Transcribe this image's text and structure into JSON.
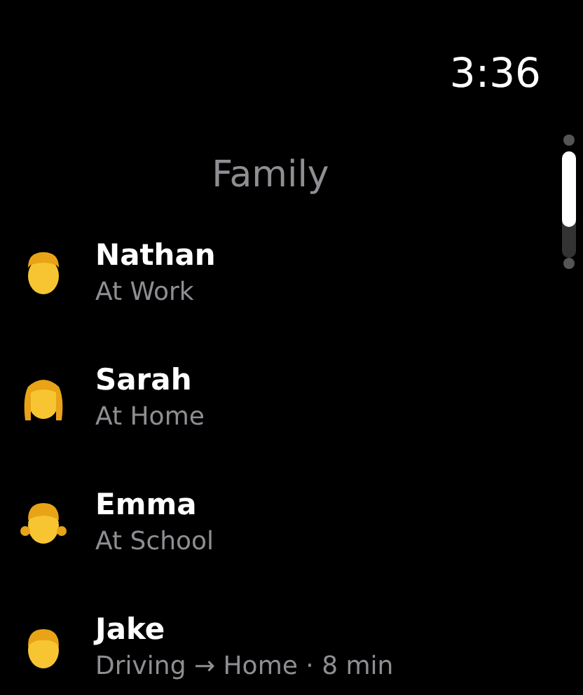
{
  "status_bar": {
    "time": "3:36"
  },
  "title": "Family",
  "members": [
    {
      "name": "Nathan",
      "status": "At Work",
      "kind": "man"
    },
    {
      "name": "Sarah",
      "status": "At Home",
      "kind": "woman"
    },
    {
      "name": "Emma",
      "status": "At School",
      "kind": "girl"
    },
    {
      "name": "Jake",
      "status": "Driving → Home · 8 min",
      "kind": "boy"
    }
  ]
}
